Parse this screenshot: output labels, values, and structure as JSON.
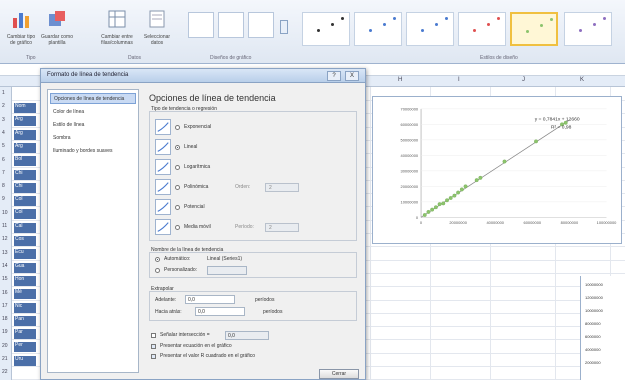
{
  "ribbon": {
    "buttons": [
      {
        "label": "Cambiar tipo de gráfico",
        "icon": "chart-type-icon"
      },
      {
        "label": "Guardar como plantilla",
        "icon": "save-template-icon"
      },
      {
        "label": "Cambiar entre filas/columnas",
        "icon": "switch-row-column-icon"
      },
      {
        "label": "Seleccionar datos",
        "icon": "select-data-icon"
      }
    ],
    "groups": [
      "Tipo",
      "Datos",
      "Diseños de gráfico",
      "Estilos de diseño"
    ],
    "accent": "#f0c040"
  },
  "sheet": {
    "columns": [
      "H",
      "I",
      "J",
      "K"
    ],
    "rows": [
      "1",
      "2",
      "3",
      "4",
      "5",
      "6",
      "7",
      "8",
      "9",
      "10",
      "11",
      "12",
      "13",
      "14",
      "15",
      "16",
      "17",
      "18",
      "19",
      "20",
      "21",
      "22"
    ],
    "col_a_values": [
      "Nom",
      "Arg",
      "Arg",
      "Arg",
      "Bol",
      "Chi",
      "Chi",
      "Col",
      "Col",
      "Cal",
      "Cos",
      "Ecu",
      "Gua",
      "Hon",
      "Mé",
      "Nic",
      "Pan",
      "Par",
      "Per",
      "Uru"
    ],
    "right_table": [
      "10000000",
      "12000000",
      "10000000",
      "8000000",
      "6000000",
      "4000000",
      "2000000"
    ]
  },
  "chart_data": {
    "type": "scatter",
    "y_ticks": [
      "70000000",
      "60000000",
      "50000000",
      "40000000",
      "30000000",
      "20000000",
      "10000000",
      "0"
    ],
    "x_ticks": [
      "0",
      "20000000",
      "40000000",
      "60000000",
      "80000000",
      "100000000"
    ],
    "ylim": [
      0,
      70000000
    ],
    "xlim": [
      0,
      100000000
    ],
    "equation": "y = 0,7841x + 12660",
    "r2": "R² = 0,98",
    "points": [
      [
        2000000,
        1500000
      ],
      [
        4000000,
        3500000
      ],
      [
        6000000,
        5000000
      ],
      [
        8000000,
        6500000
      ],
      [
        10000000,
        8500000
      ],
      [
        12000000,
        9000000
      ],
      [
        14000000,
        11000000
      ],
      [
        16000000,
        12500000
      ],
      [
        18000000,
        14000000
      ],
      [
        20000000,
        16000000
      ],
      [
        22000000,
        18000000
      ],
      [
        24000000,
        20000000
      ],
      [
        30000000,
        24000000
      ],
      [
        32000000,
        25500000
      ],
      [
        45000000,
        36000000
      ],
      [
        62000000,
        49000000
      ],
      [
        76000000,
        60000000
      ],
      [
        78000000,
        61000000
      ]
    ],
    "point_color": "#8cc46c",
    "trend_color": "#888888"
  },
  "dialog": {
    "title": "Formato de línea de tendencia",
    "nav": [
      "Opciones de línea de tendencia",
      "Color de línea",
      "Estilo de línea",
      "Sombra",
      "Iluminado y bordes suaves"
    ],
    "panel_title": "Opciones de línea de tendencia",
    "type_section": "Tipo de tendencia o regresión",
    "types": [
      {
        "label": "Exponencial",
        "on": false
      },
      {
        "label": "Lineal",
        "on": true
      },
      {
        "label": "Logarítmica",
        "on": false
      },
      {
        "label": "Polinómica",
        "on": false,
        "extra": "Orden:",
        "value": "2"
      },
      {
        "label": "Potencial",
        "on": false
      },
      {
        "label": "Media móvil",
        "on": false,
        "extra": "Período:",
        "value": "2"
      }
    ],
    "name_section": "Nombre de la línea de tendencia",
    "name_options": [
      {
        "label": "Automático:",
        "on": true,
        "value": "Lineal (Series1)"
      },
      {
        "label": "Personalizado:",
        "on": false,
        "value": ""
      }
    ],
    "forecast_section": "Extrapolar",
    "forecast": [
      {
        "label": "Adelante:",
        "value": "0,0",
        "unit": "períodos"
      },
      {
        "label": "Hacia atrás:",
        "value": "0,0",
        "unit": "períodos"
      }
    ],
    "checks": [
      {
        "label": "Señalar intersección =",
        "on": false,
        "value": "0,0"
      },
      {
        "label": "Presentar ecuación en el gráfico",
        "on": true
      },
      {
        "label": "Presentar el valor R cuadrado en el gráfico",
        "on": true
      }
    ],
    "close_label": "Cerrar",
    "help_label": "?",
    "x_label": "X"
  }
}
